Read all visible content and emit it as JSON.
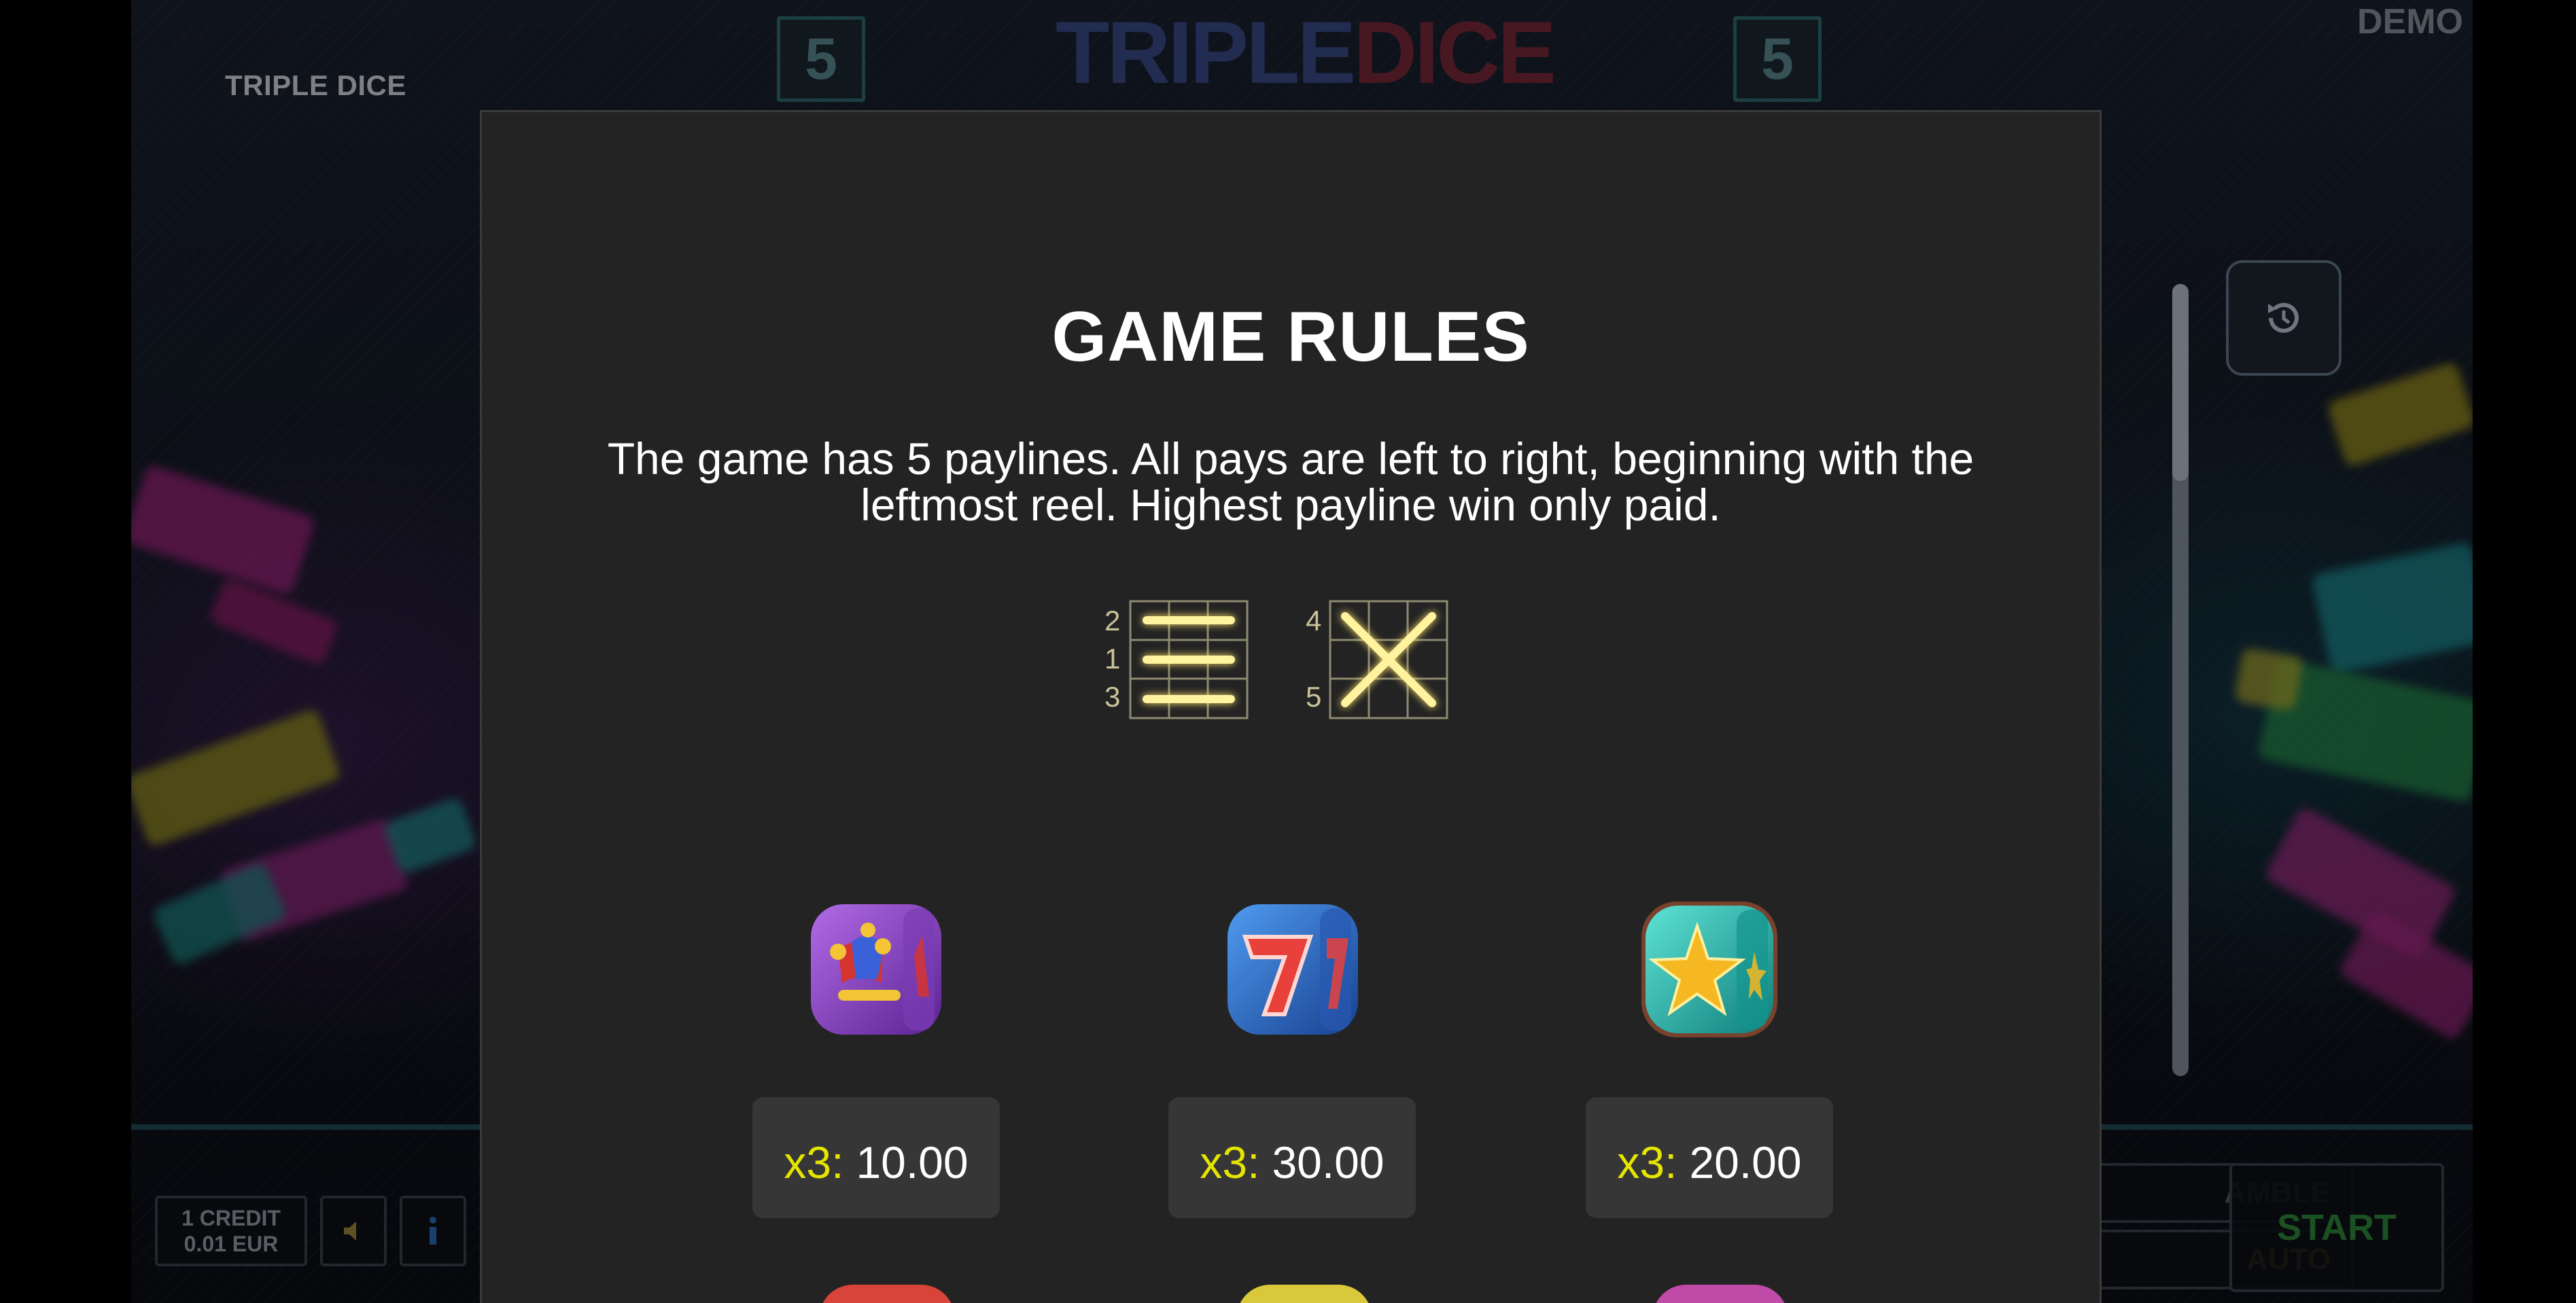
{
  "header": {
    "game_name": "TRIPLE DICE",
    "demo_label": "DEMO",
    "logo_left": "TRIPLE",
    "logo_right": "DICE",
    "lines_left": "5",
    "lines_right": "5"
  },
  "controls": {
    "close_icon": "close-icon",
    "history_icon": "history-icon",
    "credit_line1": "1 CREDIT",
    "credit_line2": "0.01 EUR",
    "sound_icon": "speaker-icon",
    "info_icon": "info-icon",
    "gamble_label": "AMBLE",
    "auto_label": "AUTO",
    "start_label": "START",
    "scroll_position": 0.0
  },
  "rules": {
    "title": "GAME RULES",
    "description": "The game has 5 paylines. All pays are left to right, beginning with the leftmost reel. Highest payline win only paid.",
    "payline_numbers": {
      "left_grid": [
        "2",
        "1",
        "3"
      ],
      "right_grid": [
        "4",
        "5"
      ]
    },
    "paytable": [
      {
        "symbol": "jester-dice",
        "multiplier": "x3:",
        "value": "10.00"
      },
      {
        "symbol": "seven-dice",
        "multiplier": "x3:",
        "value": "30.00"
      },
      {
        "symbol": "star-dice",
        "multiplier": "x3:",
        "value": "20.00"
      }
    ]
  },
  "colors": {
    "dialog_bg": "#232323",
    "pay_box_bg": "#363636",
    "multiplier_yellow": "#e5e500",
    "payline_glow": "#fff3a0",
    "start_green": "#2f8a3c",
    "auto_yellow": "#c6a020"
  }
}
